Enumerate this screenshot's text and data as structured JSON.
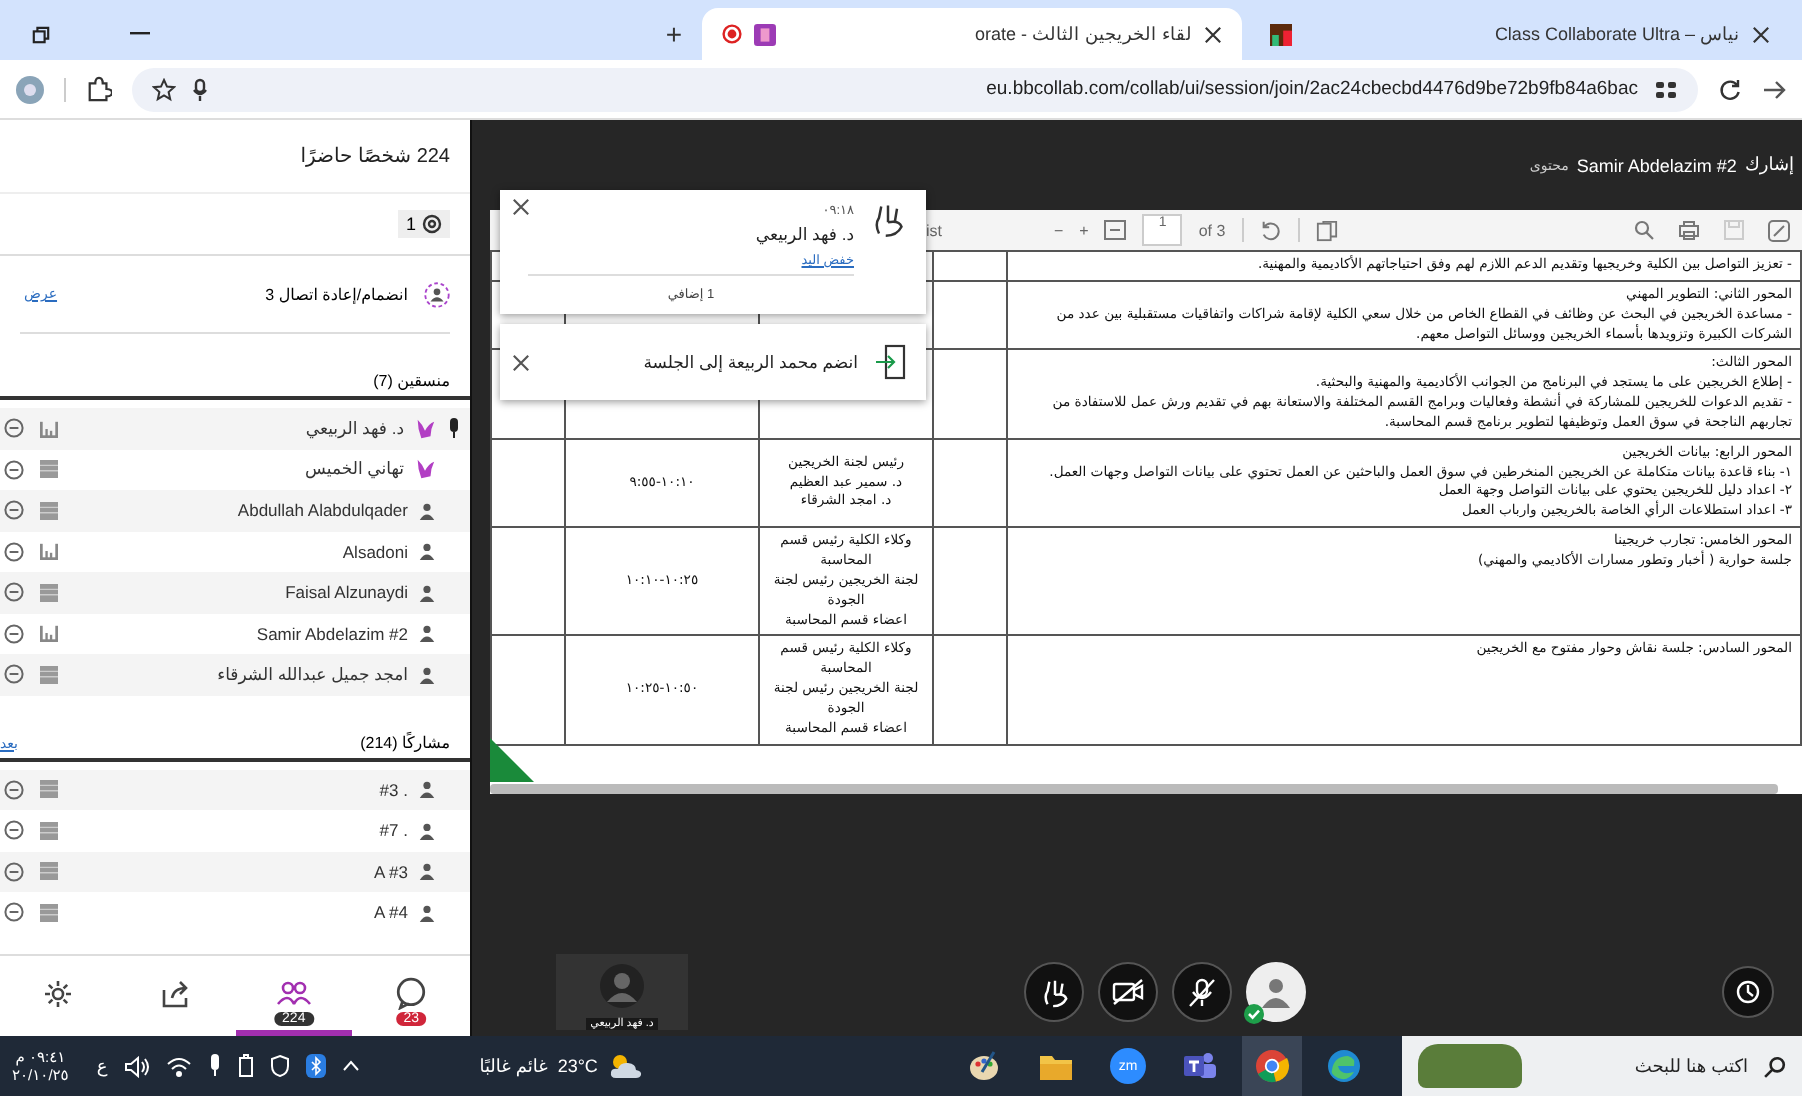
{
  "browser": {
    "tabs": [
      {
        "title": "نياس – Class Collaborate Ultra",
        "selected": false,
        "recording": false
      },
      {
        "title": "لقاء الخريجين الثالث - orate",
        "selected": true,
        "recording": true
      }
    ],
    "new_tab": "+",
    "url": "eu.bbcollab.com/collab/ui/session/join/2ac24cbecbd4476d9be72b9fb84a6bac"
  },
  "attendees_panel": {
    "title": "224 شخصًا حاضرًا",
    "filter_count": "1",
    "reconnect": {
      "label": "انضمام/إعادة اتصال 3",
      "link": "عرض"
    },
    "sections": [
      {
        "title": "منسقين (7)",
        "members": [
          {
            "name": "د. فهد الربيعي",
            "kind": "moderator",
            "talking": true,
            "meter_active": true
          },
          {
            "name": "تهاني الخميس",
            "kind": "moderator",
            "talking": false,
            "meter_active": false
          },
          {
            "name": "Abdullah Alabdulqader",
            "kind": "participant",
            "talking": false,
            "meter_active": false
          },
          {
            "name": "Alsadoni",
            "kind": "participant",
            "talking": false,
            "meter_active": true
          },
          {
            "name": "Faisal Alzunaydi",
            "kind": "participant",
            "talking": false,
            "meter_active": false
          },
          {
            "name": "Samir Abdelazim #2",
            "kind": "participant",
            "talking": false,
            "meter_active": true
          },
          {
            "name": "امجد جميل عبدالله الشرقاء",
            "kind": "participant",
            "talking": false,
            "meter_active": false
          }
        ]
      },
      {
        "title": "مشاركًا (214)",
        "link": "بعد",
        "members": [
          {
            "name": ". #3",
            "kind": "participant",
            "talking": false,
            "meter_active": false
          },
          {
            "name": ". #7",
            "kind": "participant",
            "talking": false,
            "meter_active": false
          },
          {
            "name": "A #3",
            "kind": "participant",
            "talking": false,
            "meter_active": false
          },
          {
            "name": "A #4",
            "kind": "participant",
            "talking": false,
            "meter_active": false
          }
        ]
      }
    ],
    "tabs": [
      {
        "kind": "chat",
        "badge": "23",
        "selected": false
      },
      {
        "kind": "attendees",
        "badge": "224",
        "selected": true
      },
      {
        "kind": "share",
        "selected": false
      },
      {
        "kind": "settings",
        "selected": false
      }
    ]
  },
  "stage": {
    "prefix": "إشارك",
    "presenter": "Samir Abdelazim #2",
    "suffix": "محتوى",
    "viewer": {
      "cut_label": "ist",
      "zoom_out": "−",
      "zoom_in": "+",
      "page": "1",
      "page_count": "of 3",
      "rows": [
        {
          "text": [
            "- تعزيز التواصل بين الكلية وخريجيها وتقديم الدعم اللازم لهم وفق احتياجاتهم الأكاديمية والمهنية."
          ]
        },
        {
          "text": [
            "المحور الثاني: التطوير المهني",
            "- مساعدة الخريجين في البحث عن وظائف في القطاع الخاص من خلال سعي الكلية لإقامة شراكات واتفاقيات مستقبلية بين عدد من الشركات الكبيرة وتزويدها بأسماء الخريجين ووسائل التواصل معهم."
          ]
        },
        {
          "text": [
            "المحور الثالث:",
            "- إطلاع الخريجين على ما يستجد في البرنامج من الجوانب الأكاديمية والمهنية والبحثية.",
            "- تقديم الدعوات للخريجين للمشاركة في أنشطة وفعاليات وبرامج القسم المختلفة والاستعانة بهم في تقديم ورش عمل للاستفادة من تجاربهم الناجحة في سوق العمل وتوظيفها لتطوير برنامج قسم المحاسبة."
          ]
        },
        {
          "time": "١٠:١٠-٩:٥٥",
          "people": [
            "رئيس لجنة الخريجين",
            "د. سمير عبد العظيم",
            "د. امجد الشرقاء"
          ],
          "text": [
            "المحور الرابع: بيانات الخريجين",
            "١- بناء قاعدة بيانات متكاملة عن الخريجين المنخرطين في سوق العمل والباحثين عن العمل تحتوي على بيانات التواصل وجهات العمل.",
            "٢- اعداد دليل للخريجين يحتوي على بيانات التواصل وجهة العمل",
            "٣- اعداد استطلاعات الرأي الخاصة بالخريجين وارباب العمل"
          ]
        },
        {
          "time": "١٠:٢٥-١٠:١٠",
          "people": [
            "وكلاء الكلية رئيس قسم المحاسبة",
            "لجنة الخريجين رئيس لجنة الجودة",
            "اعضاء قسم المحاسبة"
          ],
          "text": [
            "المحور الخامس: تجارب خريجينا",
            "جلسة حوارية ( أخبار وتطور مسارات الأكاديمي والمهني)"
          ]
        },
        {
          "time": "١٠:٥٠-١٠:٢٥",
          "people": [
            "وكلاء الكلية رئيس قسم المحاسبة",
            "لجنة الخريجين رئيس لجنة الجودة",
            "اعضاء قسم المحاسبة"
          ],
          "text": [
            "المحور السادس: جلسة نقاش وحوار مفتوح مع الخريجين"
          ]
        }
      ]
    },
    "notifications": [
      {
        "kind": "raised_hand",
        "time": "٠٩:١٨",
        "name": "د. فهد الربيعي",
        "action": "خفض اليد",
        "more": "1 إضافي"
      },
      {
        "kind": "joined",
        "message": "انضم محمد الربيعة إلى الجلسة"
      }
    ],
    "video_tile": {
      "name": "د. فهد الربيعي"
    },
    "controls": [
      {
        "kind": "hand"
      },
      {
        "kind": "camera",
        "off": true
      },
      {
        "kind": "mic",
        "off": true
      },
      {
        "kind": "avatar"
      }
    ]
  },
  "taskbar": {
    "search_placeholder": "اكتب هنا للبحث",
    "apps": [
      {
        "kind": "edge",
        "selected": false
      },
      {
        "kind": "chrome",
        "selected": true
      },
      {
        "kind": "teams",
        "selected": false
      },
      {
        "kind": "zoom",
        "label": "zm",
        "selected": false
      },
      {
        "kind": "files",
        "selected": false
      },
      {
        "kind": "paint",
        "selected": false
      }
    ],
    "weather": {
      "temp": "23°C",
      "condition": "غائم غالبًا"
    },
    "language": "ع",
    "time": "٠٩:٤١ م",
    "date": "٢٠/١٠/٢٥"
  }
}
